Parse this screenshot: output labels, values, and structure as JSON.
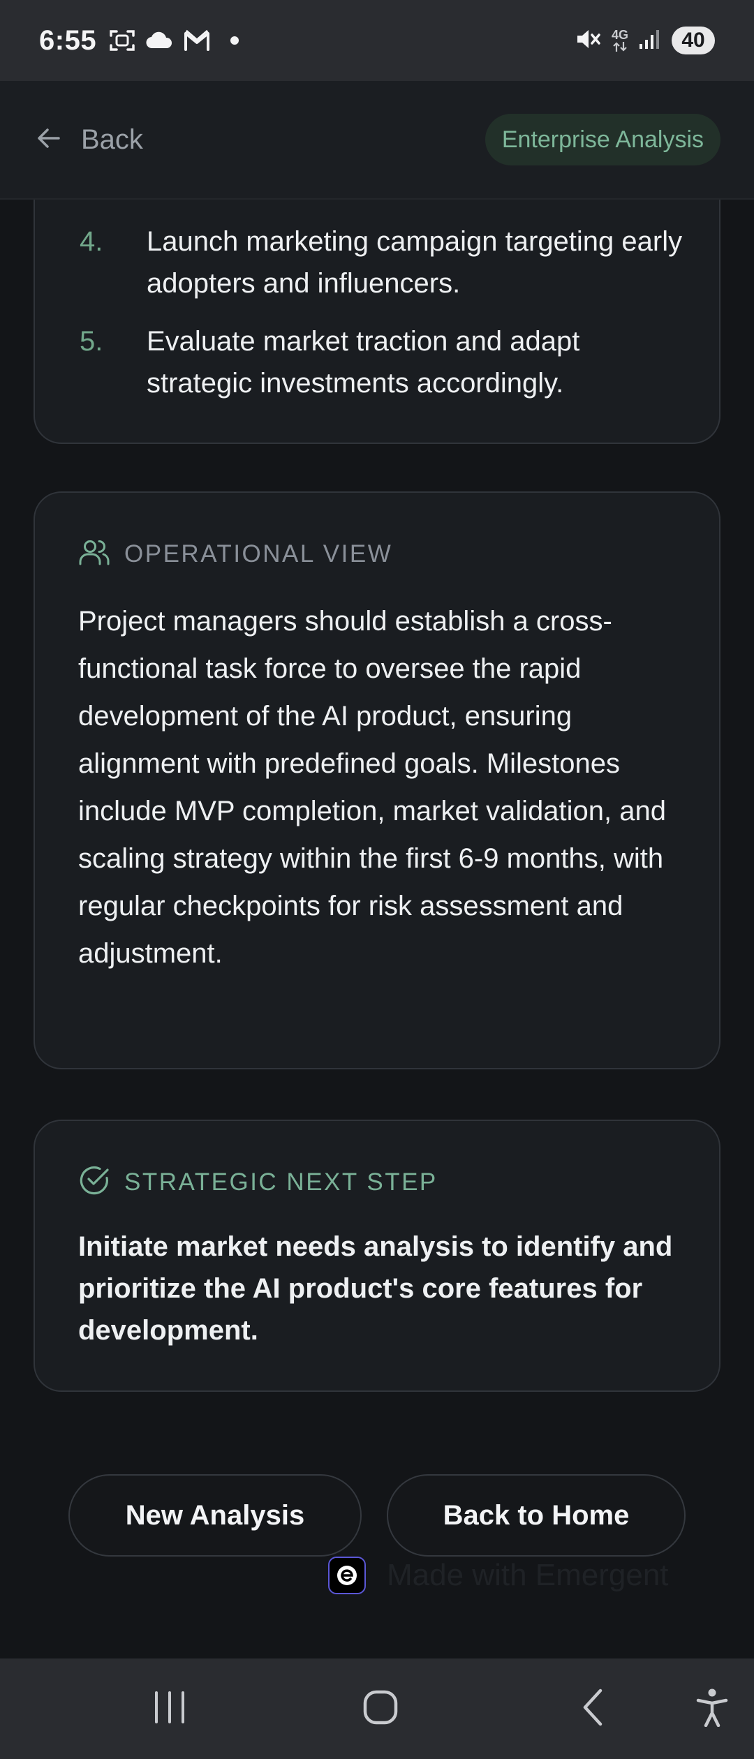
{
  "status_bar": {
    "time": "6:55",
    "network": "4G",
    "battery": "40",
    "icons": [
      "screenshot-icon",
      "cloud-icon",
      "gmail-icon",
      "notification-dot",
      "mute-icon",
      "network-arrows-icon",
      "signal-icon",
      "battery-icon"
    ]
  },
  "header": {
    "back_label": "Back",
    "badge": "Enterprise Analysis"
  },
  "steps": [
    {
      "number": "4.",
      "text": "Launch marketing campaign targeting early adopters and influencers."
    },
    {
      "number": "5.",
      "text": "Evaluate market traction and adapt strategic investments accordingly."
    }
  ],
  "operational": {
    "label": "OPERATIONAL VIEW",
    "icon": "users-icon",
    "body": "Project managers should establish a cross-functional task force to oversee the rapid development of the AI product, ensuring alignment with predefined goals. Milestones include MVP completion, market validation, and scaling strategy within the first 6-9 months, with regular checkpoints for risk assessment and adjustment."
  },
  "next_step": {
    "label": "STRATEGIC NEXT STEP",
    "icon": "check-circle-icon",
    "body": "Initiate market needs analysis to identify and prioritize the AI product's core features for development."
  },
  "actions": {
    "new_analysis": "New Analysis",
    "back_home": "Back to Home"
  },
  "footer": {
    "made_with": "Made with Emergent"
  },
  "colors": {
    "background": "#131518",
    "card": "#1a1d21",
    "accent_green": "#7ab197",
    "muted": "#8a9099"
  }
}
